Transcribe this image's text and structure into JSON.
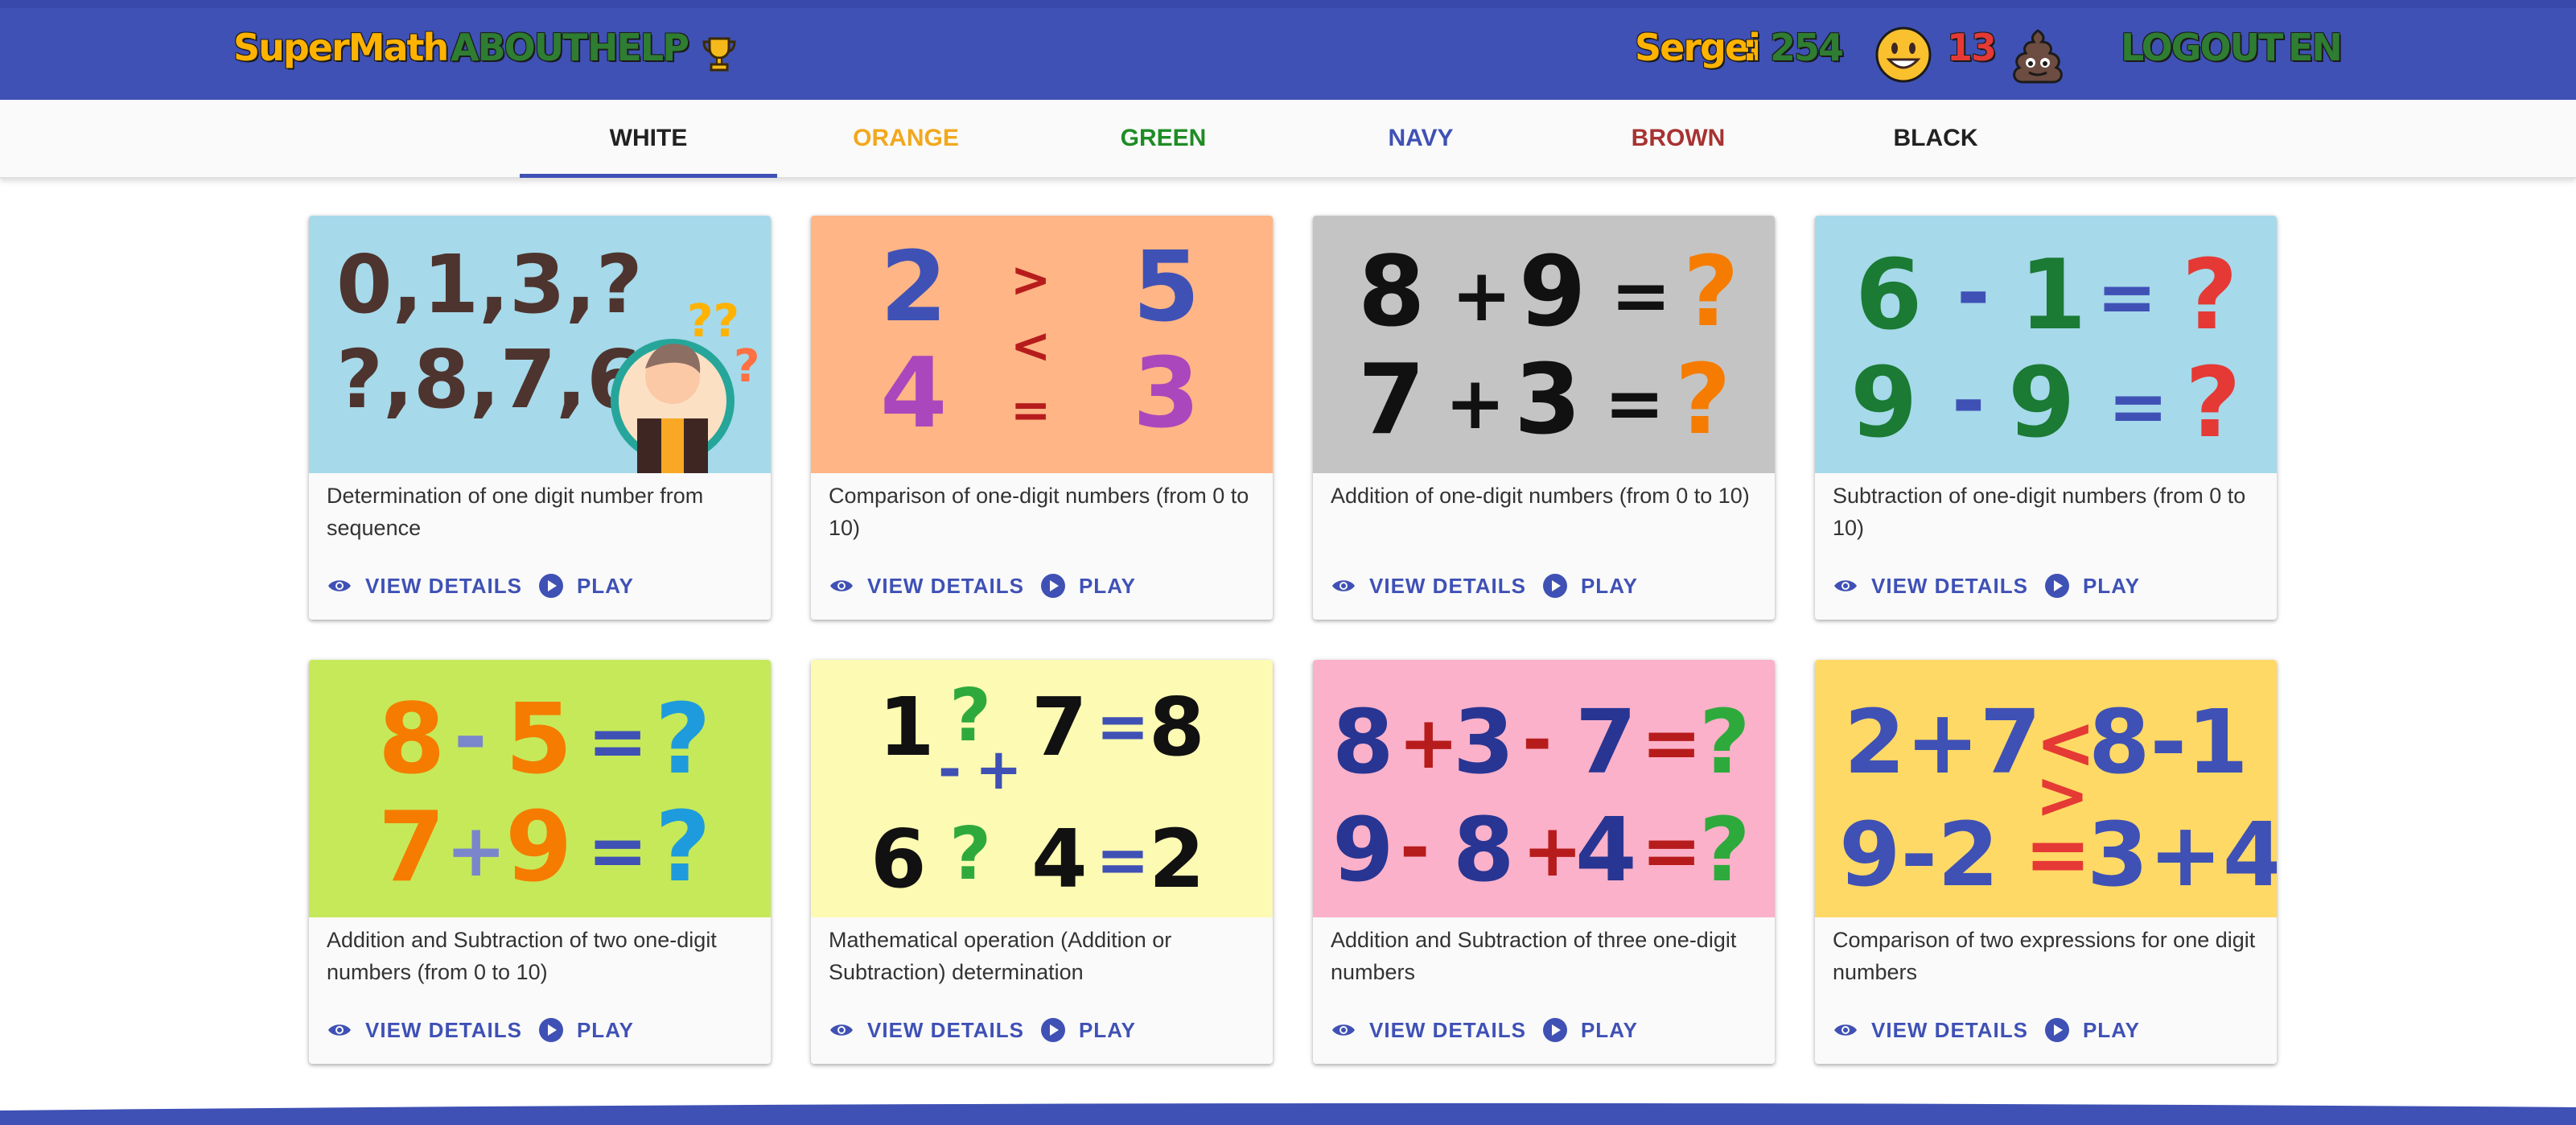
{
  "header": {
    "logo": "SuperMath",
    "about": "ABOUT",
    "help": "HELP",
    "user": "Sergei",
    "colon": ":",
    "score": "254",
    "bad_count": "13",
    "logout": "LOGOUT",
    "language": "EN",
    "icons": [
      "trophy-icon",
      "smile-emoji-icon",
      "poop-emoji-icon"
    ]
  },
  "tabs": [
    {
      "label": "WHITE",
      "color": "#212121"
    },
    {
      "label": "ORANGE",
      "color": "#f2a81d"
    },
    {
      "label": "GREEN",
      "color": "#1e8c25"
    },
    {
      "label": "NAVY",
      "color": "#3f51b5"
    },
    {
      "label": "BROWN",
      "color": "#a83232"
    },
    {
      "label": "BLACK",
      "color": "#212121"
    }
  ],
  "active_tab": "WHITE",
  "actions": {
    "details": "VIEW DETAILS",
    "play": "PLAY"
  },
  "cards": [
    {
      "description": "Determination of one digit number from sequence",
      "bg": "#a6d9ea",
      "image_text": [
        "0,1,3,?",
        "?,8,7,6"
      ]
    },
    {
      "description": "Comparison of one-digit numbers (from 0 to 10)",
      "bg": "#ffb585",
      "image_text": [
        "2",
        ">",
        "5",
        "<",
        "4",
        "=",
        "3"
      ]
    },
    {
      "description": "Addition of one-digit numbers (from 0 to 10)",
      "bg": "#c4c4c4",
      "image_text": [
        "8",
        "+",
        "9",
        "=",
        "?",
        "7",
        "+",
        "3",
        "=",
        "?"
      ]
    },
    {
      "description": "Subtraction of one-digit numbers (from 0 to 10)",
      "bg": "#a6d9ea",
      "image_text": [
        "6",
        "-",
        "1",
        "=",
        "?",
        "9",
        "-",
        "9",
        "=",
        "?"
      ]
    },
    {
      "description": "Addition and Subtraction of two one-digit numbers (from 0 to 10)",
      "bg": "#c6e95a",
      "image_text": [
        "8",
        "-",
        "5",
        "=",
        "?",
        "7",
        "+",
        "9",
        "=",
        "?"
      ]
    },
    {
      "description": "Mathematical operation (Addition or Subtraction) determination",
      "bg": "#fdfab3",
      "image_text": [
        "1",
        "?",
        "7",
        "=",
        "8",
        "-",
        "+",
        "6",
        "?",
        "4",
        "=",
        "2"
      ]
    },
    {
      "description": "Addition and Subtraction of three one-digit numbers",
      "bg": "#fbb1c9",
      "image_text": [
        "8",
        "+",
        "3",
        "-",
        "7",
        "=",
        "?",
        "9",
        "-",
        "8",
        "+",
        "4",
        "=",
        "?"
      ]
    },
    {
      "description": "Comparison of two expressions for one digit numbers",
      "bg": "#ffd966",
      "image_text": [
        "2+7",
        "<",
        "8-1",
        ">",
        "9-2",
        "=",
        "3+4"
      ]
    }
  ]
}
